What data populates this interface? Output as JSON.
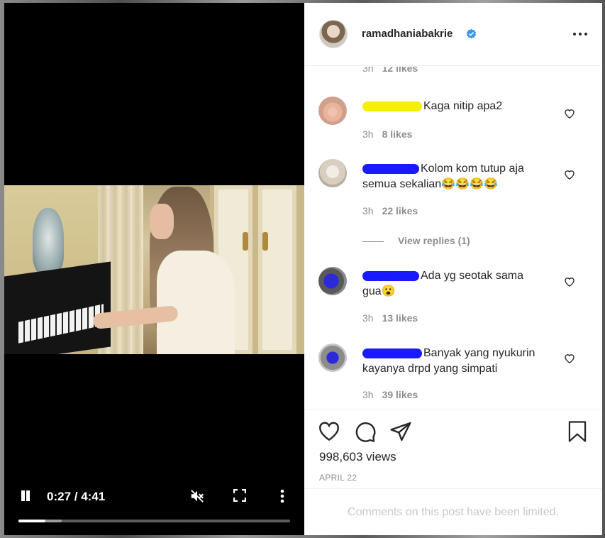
{
  "post": {
    "username": "ramadhaniabakrie",
    "views": "998,603 views",
    "date": "APRIL 22",
    "comments_limited": "Comments on this post have been limited."
  },
  "video": {
    "time": "0:27 / 4:41",
    "progress": 0.1,
    "buffered": 0.16
  },
  "comments": [
    {
      "time": "3h",
      "likes": "12 likes"
    },
    {
      "text": "Kaga nitip apa2",
      "time": "3h",
      "likes": "8 likes",
      "redact_color": "#f5f000"
    },
    {
      "text_line1": "Kolom kom tutup aja",
      "text_line2": "semua sekalian😂😂😂😂",
      "time": "3h",
      "likes": "22 likes",
      "view_replies": "View replies (1)",
      "redact_color": "#1a1aff"
    },
    {
      "text_line1": "Ada yg seotak sama",
      "text_line2": "gua😮",
      "time": "3h",
      "likes": "13 likes",
      "redact_color": "#1a1aff"
    },
    {
      "text_line1": "Banyak yang nyukurin",
      "text_line2": "kayanya drpd yang simpati",
      "time": "3h",
      "likes": "39 likes",
      "redact_color": "#1a1aff"
    }
  ],
  "colors": {
    "verified": "#3897f0",
    "text": "#262626",
    "muted": "#8e8e8e"
  }
}
